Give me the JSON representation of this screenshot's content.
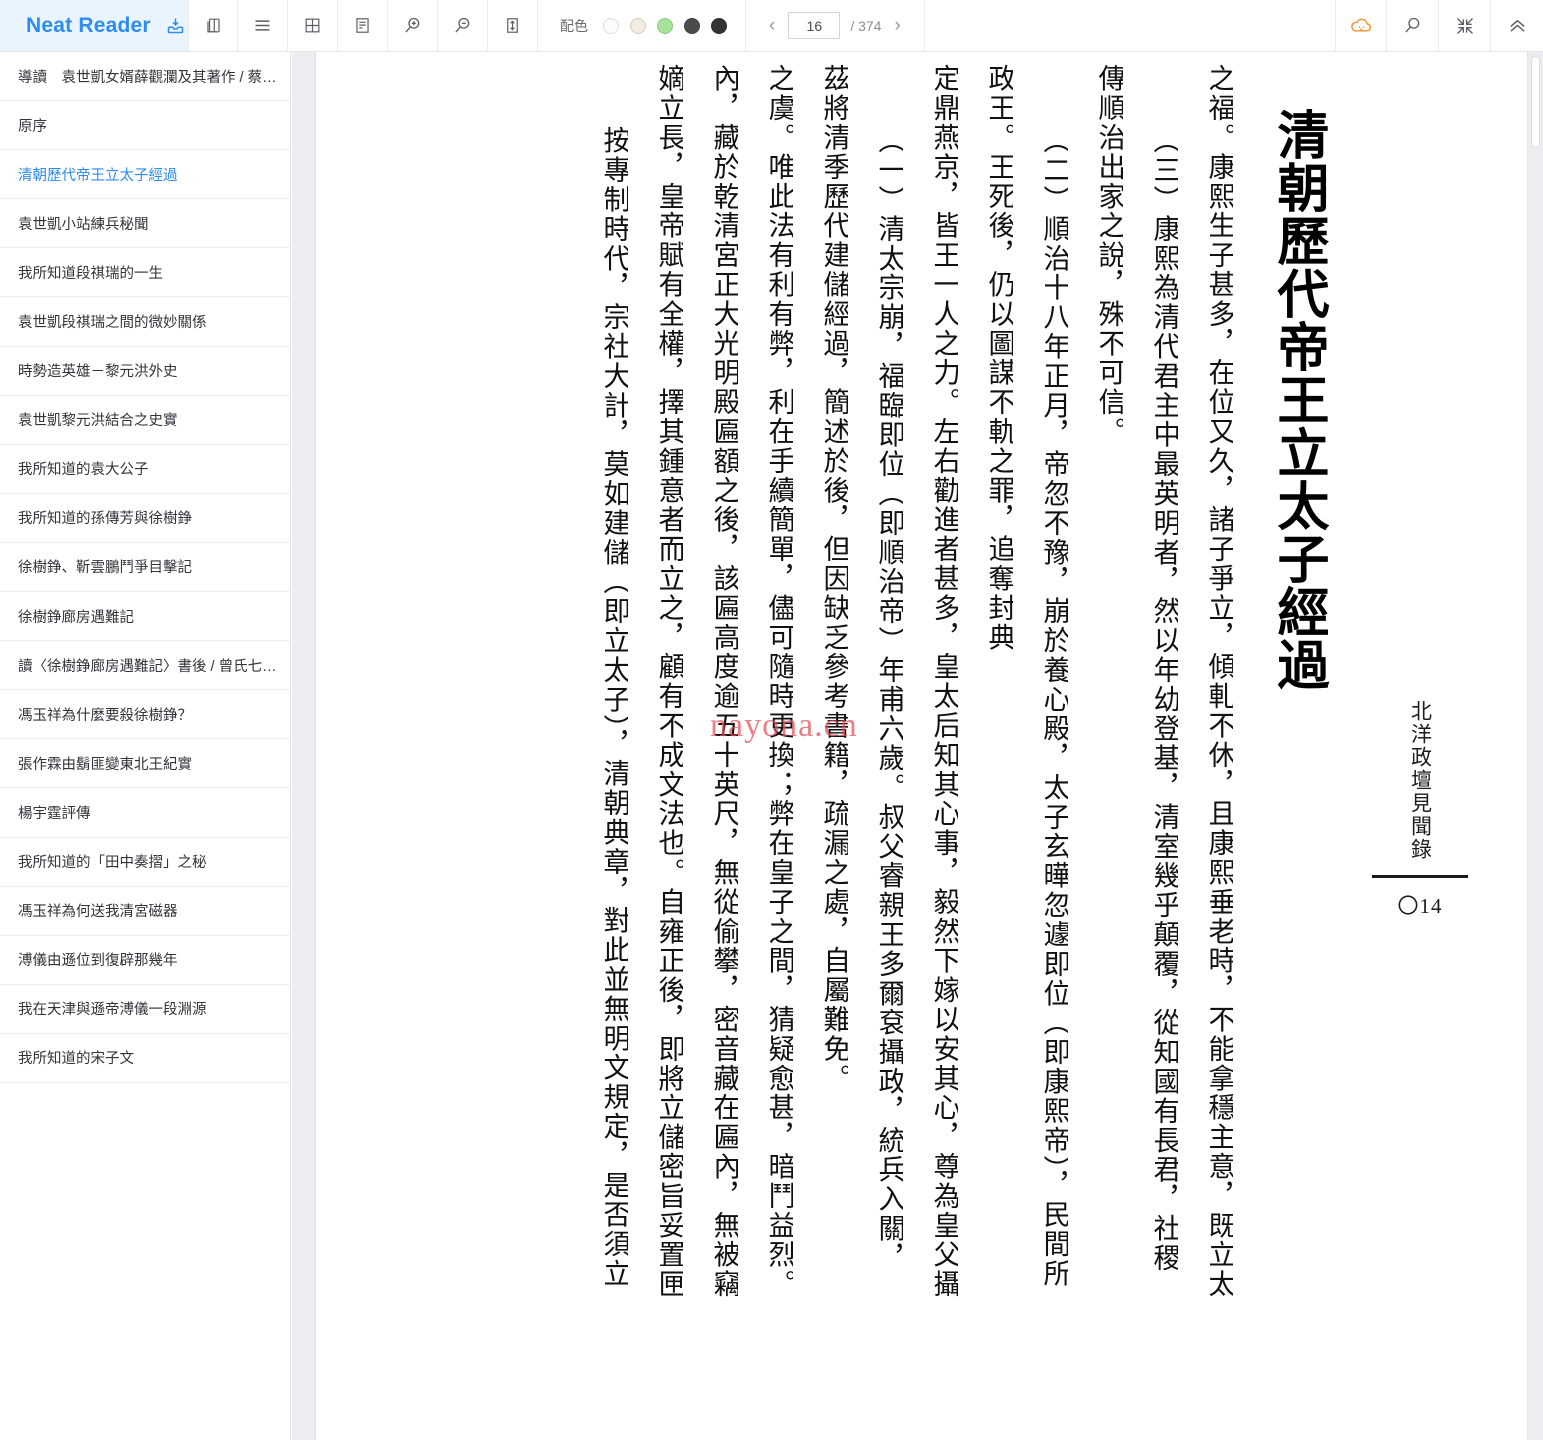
{
  "app": {
    "brand_name": "Neat Reader",
    "brand_icon": "download-inbox-icon",
    "brand_bg": "#e9f4fe",
    "brand_color": "#2c8cf0"
  },
  "toolbar": {
    "buttons": [
      {
        "name": "two-page-view-icon",
        "title": "雙頁"
      },
      {
        "name": "list-view-icon",
        "title": "目錄"
      },
      {
        "name": "grid-view-icon",
        "title": "網格"
      },
      {
        "name": "single-page-view-icon",
        "title": "單頁"
      },
      {
        "name": "zoom-in-icon",
        "title": "放大"
      },
      {
        "name": "zoom-out-icon",
        "title": "縮小"
      },
      {
        "name": "fit-height-icon",
        "title": "適應高度"
      }
    ],
    "color_scheme": {
      "label": "配色",
      "swatches": [
        {
          "name": "scheme-white",
          "color": "#fdfdfd",
          "selected": false
        },
        {
          "name": "scheme-sepia",
          "color": "#f3ece0",
          "selected": false
        },
        {
          "name": "scheme-green",
          "color": "#a5e39c",
          "selected": false
        },
        {
          "name": "scheme-gray",
          "color": "#4b4b4d",
          "selected": false
        },
        {
          "name": "scheme-black",
          "color": "#333335",
          "selected": false
        }
      ]
    },
    "pager": {
      "prev_label": "‹",
      "next_label": "›",
      "current_page": "16",
      "total_label": "/ 374",
      "placeholder": "16"
    },
    "right_buttons": [
      {
        "name": "cloud-sync-icon",
        "color": "#f0922b"
      },
      {
        "name": "search-icon",
        "color": "#595a5e"
      },
      {
        "name": "exit-fullscreen-icon",
        "color": "#595a5e"
      },
      {
        "name": "collapse-up-icon",
        "color": "#595a5e"
      }
    ]
  },
  "sidebar": {
    "items": [
      {
        "label": "導讀　袁世凱女婿薛觀瀾及其著作 / 蔡…",
        "active": false
      },
      {
        "label": "原序",
        "active": false
      },
      {
        "label": "清朝歷代帝王立太子經過",
        "active": true
      },
      {
        "label": "袁世凱小站練兵秘聞",
        "active": false
      },
      {
        "label": "我所知道段祺瑞的一生",
        "active": false
      },
      {
        "label": "袁世凱段祺瑞之間的微妙關係",
        "active": false
      },
      {
        "label": "時勢造英雄－黎元洪外史",
        "active": false
      },
      {
        "label": "袁世凱黎元洪結合之史實",
        "active": false
      },
      {
        "label": "我所知道的袁大公子",
        "active": false
      },
      {
        "label": "我所知道的孫傳芳與徐樹錚",
        "active": false
      },
      {
        "label": "徐樹錚、靳雲鵬鬥爭目擊記",
        "active": false
      },
      {
        "label": "徐樹錚廊房遇難記",
        "active": false
      },
      {
        "label": "讀〈徐樹錚廊房遇難記〉書後 / 曾氏七…",
        "active": false
      },
      {
        "label": "馮玉祥為什麼要殺徐樹錚？",
        "active": false
      },
      {
        "label": "張作霖由鬍匪變東北王紀實",
        "active": false
      },
      {
        "label": "楊宇霆評傳",
        "active": false
      },
      {
        "label": "我所知道的「田中奏摺」之秘",
        "active": false
      },
      {
        "label": "馮玉祥為何送我清宮磁器",
        "active": false
      },
      {
        "label": "溥儀由遜位到復辟那幾年",
        "active": false
      },
      {
        "label": "我在天津與遜帝溥儀一段淵源",
        "active": false
      },
      {
        "label": "我所知道的宋子文",
        "active": false
      }
    ]
  },
  "book": {
    "chapter_title": "清朝歷代帝王立太子經過",
    "running_head": "北洋政壇見聞錄",
    "folio": "〇14",
    "watermark": "nayona.cn",
    "columns": [
      {
        "text": "按專制時代，宗社大計，莫如建儲（即立太子），清朝典章，對此並無明文規定，是否須立",
        "indent": 1
      },
      {
        "text": "嫡立長，皇帝賦有全權，擇其鍾意者而立之，顧有不成文法也。自雍正後，即將立儲密旨妥置匣",
        "indent": 0
      },
      {
        "text": "內，藏於乾清宮正大光明殿匾額之後，該匾高度逾五十英尺，無從偷攀，密音藏在匾內，無被竊",
        "indent": 0
      },
      {
        "text": "之虞。唯此法有利有弊，利在手續簡單，儘可隨時更換；弊在皇子之間，猜疑愈甚，暗鬥益烈。",
        "indent": 0
      },
      {
        "text": "茲將清季歷代建儲經過，簡述於後，但因缺乏參考書籍，疏漏之處，自屬難免。",
        "indent": 0
      },
      {
        "text": "（一）清太宗崩，福臨即位（即順治帝）年甫六歲。叔父睿親王多爾袞攝政，統兵入關，",
        "indent": 1
      },
      {
        "text": "定鼎燕京，皆王一人之力。左右勸進者甚多，皇太后知其心事，毅然下嫁以安其心，尊為皇父攝",
        "indent": 0
      },
      {
        "text": "政王。王死後，仍以圖謀不軌之罪，追奪封典",
        "indent": 0
      },
      {
        "text": "（二）順治十八年正月，帝忽不豫，崩於養心殿，太子玄曄忽遽即位（即康熙帝），民間所",
        "indent": 1
      },
      {
        "text": "傳順治出家之說，殊不可信。",
        "indent": 0
      },
      {
        "text": "（三）康熙為清代君主中最英明者，然以年幼登基，清室幾乎顛覆，從知國有長君，社稷",
        "indent": 1
      },
      {
        "text": "之福。康熙生子甚多，在位又久，諸子爭立，傾軋不休，且康熙垂老時，不能拿穩主意，既立太",
        "indent": 0
      }
    ]
  }
}
